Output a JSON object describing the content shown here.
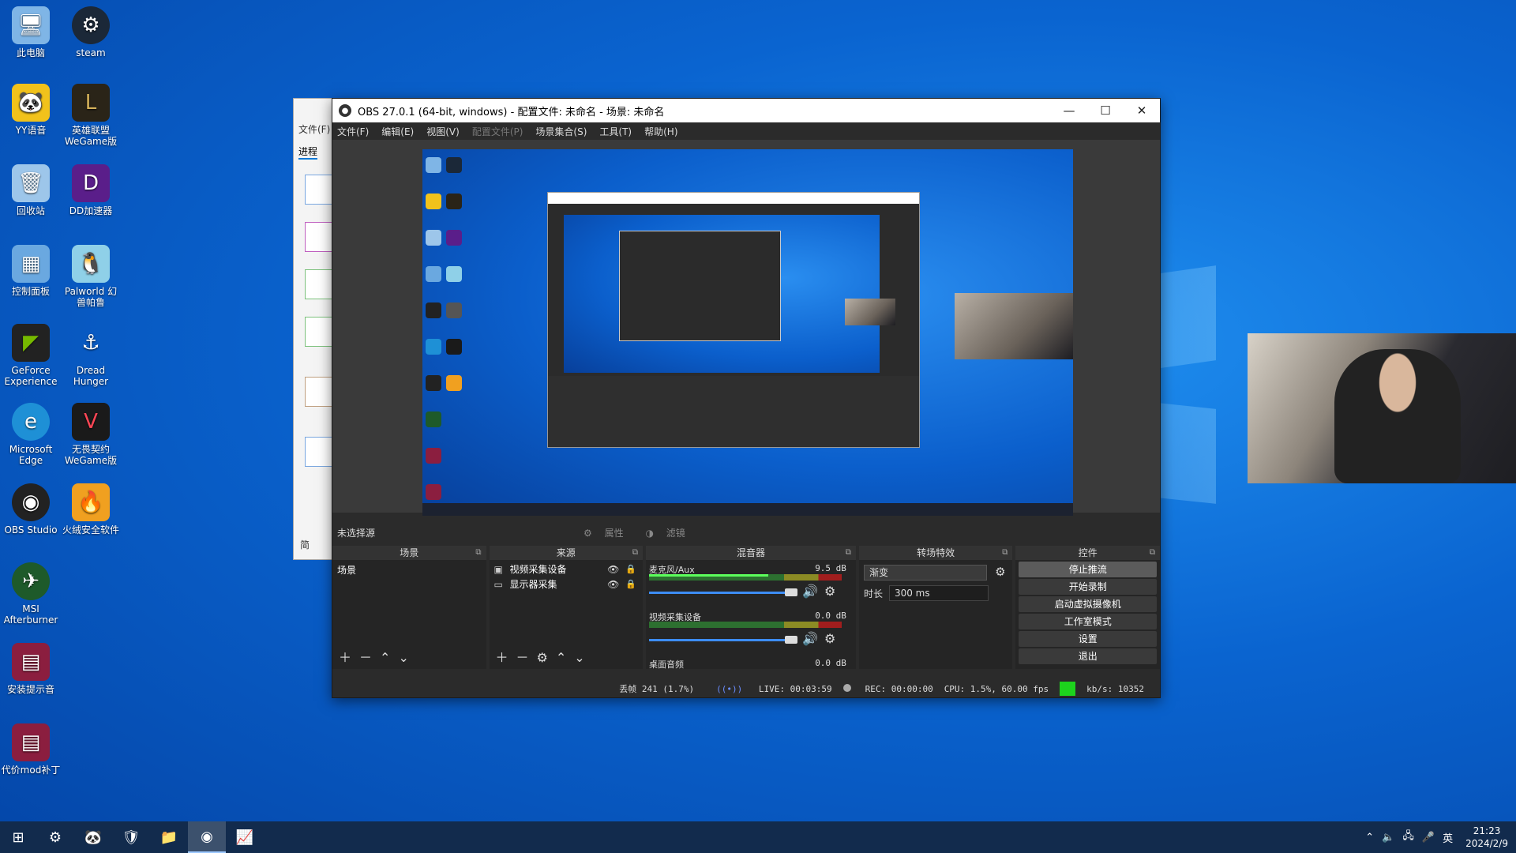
{
  "desktop": {
    "icons": [
      {
        "label": "此电脑",
        "icon": "computer-icon"
      },
      {
        "label": "steam",
        "icon": "steam-icon"
      },
      {
        "label": "YY语音",
        "icon": "yy-icon"
      },
      {
        "label": "英雄联盟WeGame版",
        "icon": "lol-icon"
      },
      {
        "label": "回收站",
        "icon": "recycle-bin-icon"
      },
      {
        "label": "DD加速器",
        "icon": "dd-icon"
      },
      {
        "label": "控制面板",
        "icon": "control-panel-icon"
      },
      {
        "label": "Palworld 幻兽帕鲁",
        "icon": "palworld-icon"
      },
      {
        "label": "GeForce Experience",
        "icon": "geforce-icon"
      },
      {
        "label": "Dread Hunger",
        "icon": "anchor-icon"
      },
      {
        "label": "Microsoft Edge",
        "icon": "edge-icon"
      },
      {
        "label": "无畏契约WeGame版",
        "icon": "valorant-icon"
      },
      {
        "label": "OBS Studio",
        "icon": "obs-icon"
      },
      {
        "label": "火绒安全软件",
        "icon": "huorong-icon"
      },
      {
        "label": "MSI Afterburner",
        "icon": "afterburner-icon"
      },
      {
        "label": "安装提示音",
        "icon": "winrar-icon"
      },
      {
        "label": "代价mod补丁",
        "icon": "winrar-icon"
      }
    ]
  },
  "bg_window": {
    "menu": "文件(F)",
    "tab": "进程",
    "collapse": "简"
  },
  "obs": {
    "title": "OBS 27.0.1 (64-bit, windows) - 配置文件: 未命名 - 场景: 未命名",
    "menu": [
      "文件(F)",
      "编辑(E)",
      "视图(V)",
      "配置文件(P)",
      "场景集合(S)",
      "工具(T)",
      "帮助(H)"
    ],
    "source_bar": {
      "label": "未选择源",
      "properties": "属性",
      "filters": "滤镜"
    },
    "docks": {
      "scenes": {
        "title": "场景",
        "items": [
          "场景"
        ]
      },
      "sources": {
        "title": "来源",
        "items": [
          {
            "label": "视频采集设备",
            "icon": "camera-icon"
          },
          {
            "label": "显示器采集",
            "icon": "monitor-icon"
          }
        ]
      },
      "mixer": {
        "title": "混音器",
        "channels": [
          {
            "name": "麦克风/Aux",
            "db": "9.5 dB",
            "level": 0.62,
            "volume": 0.85
          },
          {
            "name": "视频采集设备",
            "db": "0.0 dB",
            "level": 0.0,
            "volume": 0.85
          },
          {
            "name": "桌面音频",
            "db": "0.0 dB",
            "level": 0.0,
            "volume": 0.85
          }
        ]
      },
      "transitions": {
        "title": "转场特效",
        "selected": "渐变",
        "duration_label": "时长",
        "duration": "300 ms"
      },
      "controls": {
        "title": "控件",
        "buttons": [
          "停止推流",
          "开始录制",
          "启动虚拟摄像机",
          "工作室模式",
          "设置",
          "退出"
        ]
      }
    },
    "status": {
      "dropped": "丢帧 241 (1.7%)",
      "live": "LIVE: 00:03:59",
      "rec": "REC: 00:00:00",
      "cpu": "CPU: 1.5%, 60.00 fps",
      "kbps": "kb/s: 10352"
    }
  },
  "taskbar": {
    "apps": [
      "windows-start-icon",
      "steam-icon",
      "yy-icon",
      "huorong-icon",
      "folder-icon",
      "obs-icon",
      "taskmgr-icon"
    ],
    "tray_lang": "英",
    "time": "21:23",
    "date": "2024/2/9"
  }
}
